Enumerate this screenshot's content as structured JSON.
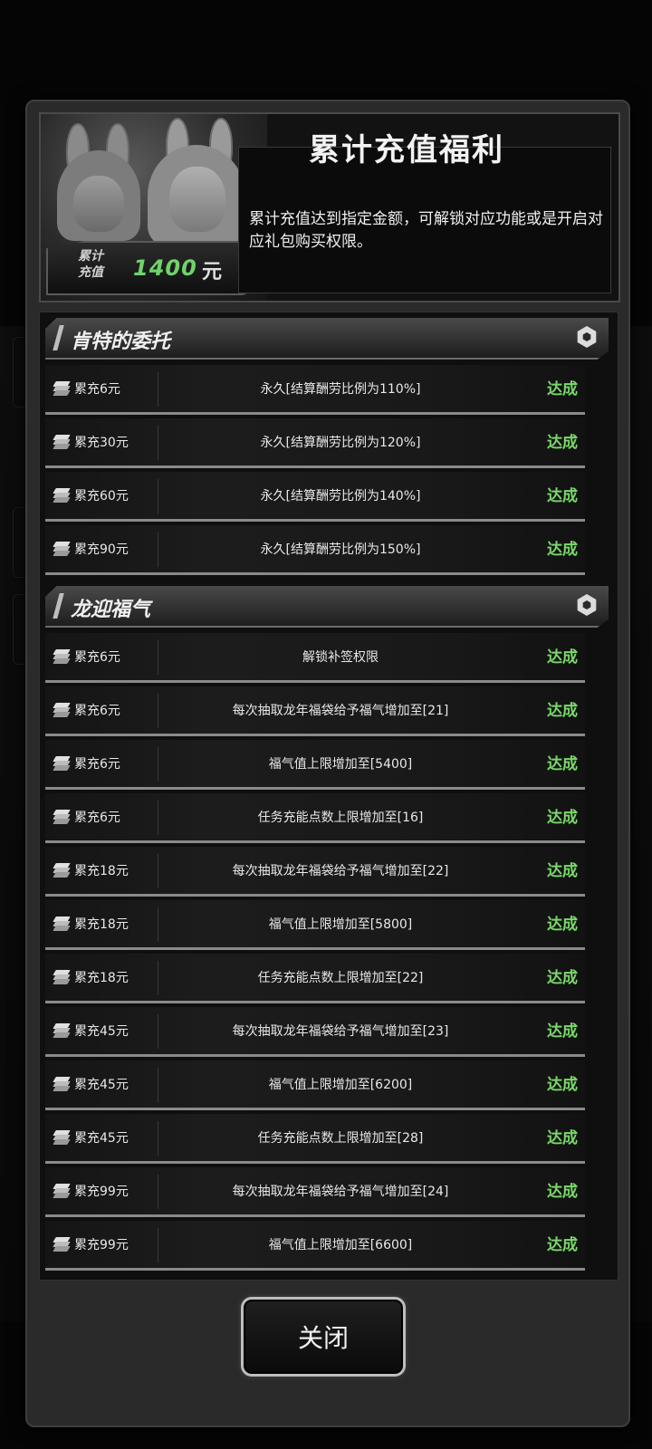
{
  "header": {
    "title": "累计充值福利",
    "description": "累计充值达到指定金额，可解锁对应功能或是开启对应礼包购买权限。",
    "recharge_label_line1": "累计",
    "recharge_label_line2": "充值",
    "recharge_amount": "1400",
    "recharge_unit": "元"
  },
  "sections": [
    {
      "title": "肯特的委托",
      "rows": [
        {
          "req": "累充6元",
          "benefit": "永久[结算酬劳比例为110%]",
          "status": "达成"
        },
        {
          "req": "累充30元",
          "benefit": "永久[结算酬劳比例为120%]",
          "status": "达成"
        },
        {
          "req": "累充60元",
          "benefit": "永久[结算酬劳比例为140%]",
          "status": "达成"
        },
        {
          "req": "累充90元",
          "benefit": "永久[结算酬劳比例为150%]",
          "status": "达成"
        }
      ]
    },
    {
      "title": "龙迎福气",
      "rows": [
        {
          "req": "累充6元",
          "benefit": "解锁补签权限",
          "status": "达成"
        },
        {
          "req": "累充6元",
          "benefit": "每次抽取龙年福袋给予福气增加至[21]",
          "status": "达成"
        },
        {
          "req": "累充6元",
          "benefit": "福气值上限增加至[5400]",
          "status": "达成"
        },
        {
          "req": "累充6元",
          "benefit": "任务充能点数上限增加至[16]",
          "status": "达成"
        },
        {
          "req": "累充18元",
          "benefit": "每次抽取龙年福袋给予福气增加至[22]",
          "status": "达成"
        },
        {
          "req": "累充18元",
          "benefit": "福气值上限增加至[5800]",
          "status": "达成"
        },
        {
          "req": "累充18元",
          "benefit": "任务充能点数上限增加至[22]",
          "status": "达成"
        },
        {
          "req": "累充45元",
          "benefit": "每次抽取龙年福袋给予福气增加至[23]",
          "status": "达成"
        },
        {
          "req": "累充45元",
          "benefit": "福气值上限增加至[6200]",
          "status": "达成"
        },
        {
          "req": "累充45元",
          "benefit": "任务充能点数上限增加至[28]",
          "status": "达成"
        },
        {
          "req": "累充99元",
          "benefit": "每次抽取龙年福袋给予福气增加至[24]",
          "status": "达成"
        },
        {
          "req": "累充99元",
          "benefit": "福气值上限增加至[6600]",
          "status": "达成"
        }
      ]
    }
  ],
  "close_button": "关闭",
  "colors": {
    "achieved": "#79d86a",
    "amount": "#6fd36a"
  }
}
